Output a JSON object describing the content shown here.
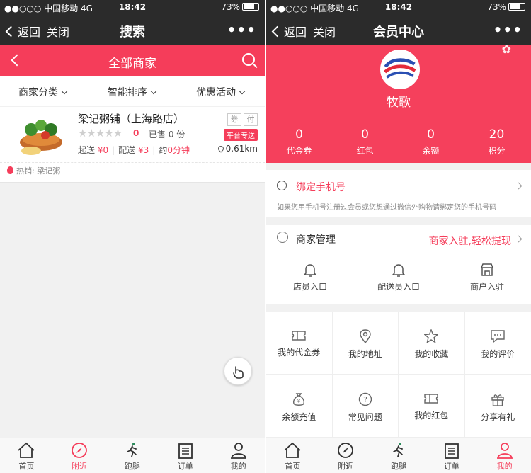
{
  "colors": {
    "accent": "#f53d5a",
    "topbar": "#2b2b2b"
  },
  "left": {
    "status": {
      "carrier": "●●○○○ 中国移动  4G",
      "time": "18:42",
      "battery": "73%"
    },
    "nav": {
      "back": "返回",
      "close": "关闭",
      "title": "搜索",
      "more": "•••"
    },
    "header": {
      "title": "全部商家"
    },
    "filters": [
      "商家分类",
      "智能排序",
      "优惠活动"
    ],
    "shop": {
      "name": "梁记粥铺（上海路店）",
      "stars": "★★★★★",
      "rating": "0",
      "sold": "已售 0 份",
      "badge_coupon": "券",
      "badge_pay": "付",
      "platform": "平台专送",
      "min_label": "起送",
      "min_value": "¥0",
      "delivery_label": "配送",
      "delivery_value": "¥3",
      "time_label": "约",
      "time_value": "0分钟",
      "distance": "0.61km",
      "hot": "热销: 梁记粥"
    }
  },
  "right": {
    "status": {
      "carrier": "●●○○○ 中国移动  4G",
      "time": "18:42",
      "battery": "73%"
    },
    "nav": {
      "back": "返回",
      "close": "关闭",
      "title": "会员中心",
      "more": "•••"
    },
    "member": {
      "name": "牧歌"
    },
    "stats": [
      {
        "value": "0",
        "label": "代金券"
      },
      {
        "value": "0",
        "label": "红包"
      },
      {
        "value": "0",
        "label": "余额"
      },
      {
        "value": "20",
        "label": "积分"
      }
    ],
    "bind": {
      "title": "绑定手机号",
      "desc": "如果您用手机号注册过会员或您想通过微信外购物请绑定您的手机号码"
    },
    "business": {
      "title": "商家管理",
      "promo": "商家入驻,轻松提现",
      "items": [
        "店员入口",
        "配送员入口",
        "商户入驻"
      ]
    },
    "grid": [
      "我的代金券",
      "我的地址",
      "我的收藏",
      "我的评价",
      "余额充值",
      "常见问题",
      "我的红包",
      "分享有礼"
    ]
  },
  "tabs": [
    "首页",
    "附近",
    "跑腿",
    "订单",
    "我的"
  ]
}
